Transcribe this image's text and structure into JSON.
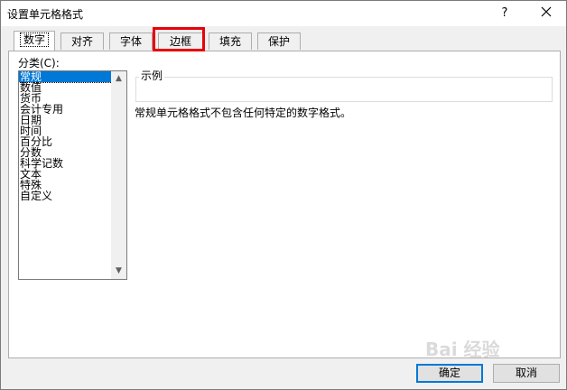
{
  "window": {
    "title": "设置单元格格式",
    "help_label": "?"
  },
  "tabs": [
    {
      "label": "数字",
      "active": true
    },
    {
      "label": "对齐",
      "active": false
    },
    {
      "label": "字体",
      "active": false
    },
    {
      "label": "边框",
      "active": false
    },
    {
      "label": "填充",
      "active": false
    },
    {
      "label": "保护",
      "active": false
    }
  ],
  "category": {
    "label": "分类(C):",
    "items": [
      "常规",
      "数值",
      "货币",
      "会计专用",
      "日期",
      "时间",
      "百分比",
      "分数",
      "科学记数",
      "文本",
      "特殊",
      "自定义"
    ],
    "selected": "常规"
  },
  "sample": {
    "label": "示例"
  },
  "description": "常规单元格格式不包含任何特定的数字格式。",
  "buttons": {
    "ok": "确定",
    "cancel": "取消"
  },
  "watermark": "Bai 经验",
  "colors": {
    "highlight": "#e8000b",
    "selection": "#0078d7"
  }
}
